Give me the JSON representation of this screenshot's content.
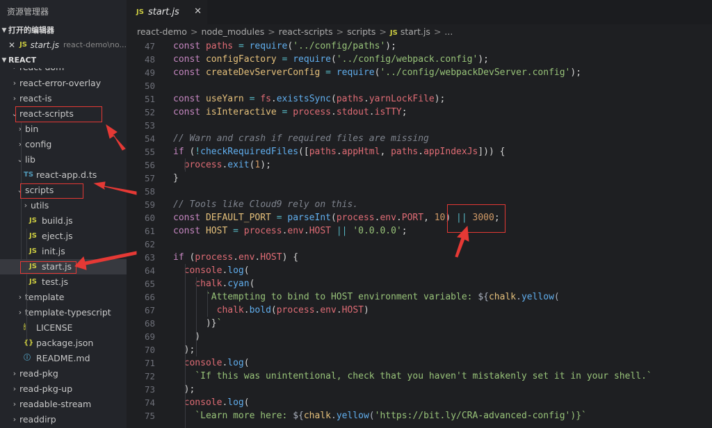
{
  "sidebar": {
    "title": "资源管理器",
    "open_editors_label": "打开的编辑器",
    "open_editor_file": {
      "close": "✕",
      "icon_label": "JS",
      "name": "start.js",
      "path": "react-demo\\no..."
    },
    "project_label": "REACT",
    "tree": [
      {
        "label": "react-dom",
        "kind": "folder"
      },
      {
        "label": "react-error-overlay",
        "kind": "folder"
      },
      {
        "label": "react-is",
        "kind": "folder"
      },
      {
        "label": "react-scripts",
        "kind": "folder-open"
      },
      {
        "label": "bin",
        "kind": "folder"
      },
      {
        "label": "config",
        "kind": "folder"
      },
      {
        "label": "lib",
        "kind": "folder-leaf"
      },
      {
        "label": "react-app.d.ts",
        "kind": "ts",
        "icon_label": "TS"
      },
      {
        "label": "scripts",
        "kind": "folder-open"
      },
      {
        "label": "utils",
        "kind": "folder"
      },
      {
        "label": "build.js",
        "kind": "js",
        "icon_label": "JS"
      },
      {
        "label": "eject.js",
        "kind": "js",
        "icon_label": "JS"
      },
      {
        "label": "init.js",
        "kind": "js",
        "icon_label": "JS"
      },
      {
        "label": "start.js",
        "kind": "js",
        "icon_label": "JS",
        "selected": true
      },
      {
        "label": "test.js",
        "kind": "js",
        "icon_label": "JS"
      },
      {
        "label": "template",
        "kind": "folder"
      },
      {
        "label": "template-typescript",
        "kind": "folder"
      },
      {
        "label": "LICENSE",
        "kind": "license",
        "icon_label": "🕯"
      },
      {
        "label": "package.json",
        "kind": "json",
        "icon_label": "{}"
      },
      {
        "label": "README.md",
        "kind": "info",
        "icon_label": "ⓘ"
      },
      {
        "label": "read-pkg",
        "kind": "folder"
      },
      {
        "label": "read-pkg-up",
        "kind": "folder"
      },
      {
        "label": "readable-stream",
        "kind": "folder"
      },
      {
        "label": "readdirp",
        "kind": "folder"
      }
    ]
  },
  "tabs": [
    {
      "icon_label": "JS",
      "label": "start.js",
      "close": "✕"
    }
  ],
  "breadcrumb": [
    "react-demo",
    "node_modules",
    "react-scripts",
    "scripts",
    "start.js",
    "..."
  ],
  "breadcrumb_sep": ">",
  "code": {
    "line_numbers": [
      "47",
      "48",
      "49",
      "50",
      "51",
      "52",
      "53",
      "54",
      "55",
      "56",
      "57",
      "58",
      "59",
      "60",
      "61",
      "62",
      "63",
      "64",
      "65",
      "66",
      "67",
      "68",
      "69",
      "70",
      "71",
      "72",
      "73",
      "74",
      "75"
    ],
    "lines": [
      "const paths = require('../config/paths');",
      "const configFactory = require('../config/webpack.config');",
      "const createDevServerConfig = require('../config/webpackDevServer.config');",
      "",
      "const useYarn = fs.existsSync(paths.yarnLockFile);",
      "const isInteractive = process.stdout.isTTY;",
      "",
      "// Warn and crash if required files are missing",
      "if (!checkRequiredFiles([paths.appHtml, paths.appIndexJs])) {",
      "  process.exit(1);",
      "}",
      "",
      "// Tools like Cloud9 rely on this.",
      "const DEFAULT_PORT = parseInt(process.env.PORT, 10) || 3000;",
      "const HOST = process.env.HOST || '0.0.0.0';",
      "",
      "if (process.env.HOST) {",
      "  console.log(",
      "    chalk.cyan(",
      "      `Attempting to bind to HOST environment variable: ${chalk.yellow(",
      "        chalk.bold(process.env.HOST)",
      "      )}`",
      "    )",
      "  );",
      "  console.log(",
      "    `If this was unintentional, check that you haven't mistakenly set it in your shell.`",
      "  );",
      "  console.log(",
      "    `Learn more here: ${chalk.yellow('https://bit.ly/CRA-advanced-config')}`"
    ]
  },
  "colors": {
    "keyword": "#c586c0",
    "function": "#61afef",
    "string": "#98c379",
    "comment": "#7f848e",
    "number": "#d19a66",
    "annotation_red": "#e53935"
  }
}
